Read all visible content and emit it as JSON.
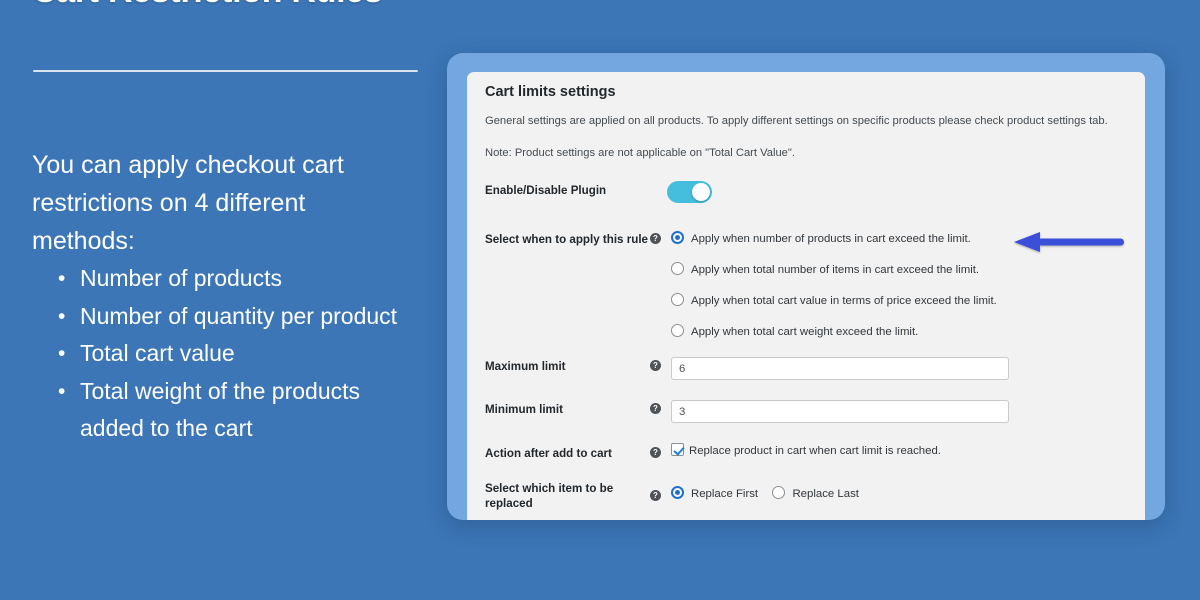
{
  "slide": {
    "title": "Cart Restriction Rules",
    "lead": "You can apply checkout cart restrictions on 4 different methods:",
    "bullets": [
      "Number of products",
      "Number of quantity per product",
      "Total cart value",
      "Total weight of the products added to the cart"
    ]
  },
  "panel": {
    "title": "Cart limits settings",
    "description_1": "General settings are applied on all products. To apply different settings on specific products please check product settings tab.",
    "description_2": "Note: Product settings are not applicable on \"Total Cart Value\".",
    "help_glyph": "?",
    "rows": {
      "enable_label": "Enable/Disable Plugin",
      "rule_label": "Select when to apply this rule",
      "max_label": "Maximum limit",
      "min_label": "Minimum limit",
      "action_label": "Action after add to cart",
      "replace_label": "Select which item to be replaced"
    },
    "toggle": {
      "state": "on"
    },
    "rule_options": [
      "Apply when number of products in cart exceed the limit.",
      "Apply when total number of items in cart exceed the limit.",
      "Apply when total cart value in terms of price exceed the limit.",
      "Apply when total cart weight exceed the limit."
    ],
    "rule_selected_index": 0,
    "max_limit_value": "6",
    "min_limit_value": "3",
    "action_checkbox_label": "Replace product in cart when cart limit is reached.",
    "action_checkbox_checked": true,
    "replace_options": [
      "Replace First",
      "Replace Last"
    ],
    "replace_selected_index": 0
  },
  "annotation": {
    "arrow_color": "#3b4fd8",
    "arrow_direction": "left"
  },
  "colors": {
    "background": "#3c76b6",
    "frame": "#74a6e0",
    "panel": "#f2f2f2",
    "toggle_on": "#45bede",
    "accent": "#1f6fd0"
  }
}
